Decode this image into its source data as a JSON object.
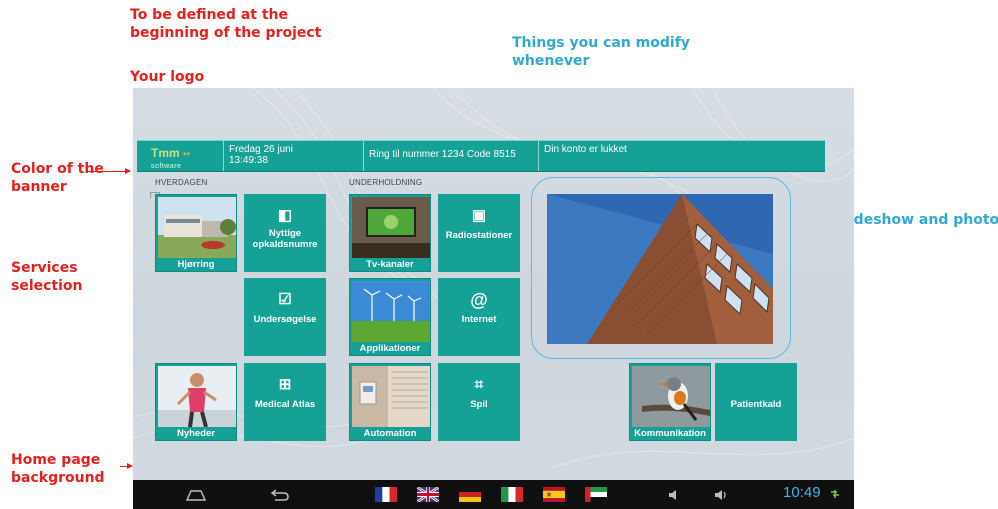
{
  "annotations": {
    "define_title": "To be defined at the beginning of the project",
    "modify_title": "Things you can modify whenever",
    "logo": "Your logo",
    "banner_color": "Color of the banner",
    "services": "Services selection",
    "home_bg": "Home page background",
    "slideshow": "Slideshow and photo"
  },
  "banner": {
    "logo_text": "Tmm",
    "logo_sub": "software",
    "date": "Fredag 26 juni",
    "time": "13:49:38",
    "call": "Ring til nummer 1234 Code 8515",
    "account": "Din konto er lukket"
  },
  "sections": {
    "everyday": "Hverdagen",
    "entertainment": "Underholdning"
  },
  "tiles": {
    "hjorring": "Hjørring",
    "nyttige": "Nyttige opkaldsnumre",
    "undersogelse": "Undersøgelse",
    "nyheder": "Nyheder",
    "medical_atlas": "Medical Atlas",
    "tv": "Tv-kanaler",
    "radio": "Radiostationer",
    "applikationer": "Applikationer",
    "internet": "Internet",
    "automation": "Automation",
    "spil": "Spil",
    "kommunikation": "Kommunikation",
    "patientkald": "Patientkald"
  },
  "icons": {
    "nyttige": "phone-book-icon",
    "undersogelse": "checkbox-icon",
    "medical_atlas": "first-aid-icon",
    "radio": "radio-icon",
    "internet": "at-icon",
    "spil": "puzzle-icon"
  },
  "navbar": {
    "clock": "10:49",
    "flags": [
      "france",
      "united-kingdom",
      "germany",
      "italy",
      "spain",
      "united-arab-emirates"
    ]
  },
  "colors": {
    "annotation_red": "#e8201d",
    "annotation_blue": "#31a8d8",
    "banner": "#16a196",
    "tile": "#16a196",
    "clock": "#3fb5e8"
  }
}
